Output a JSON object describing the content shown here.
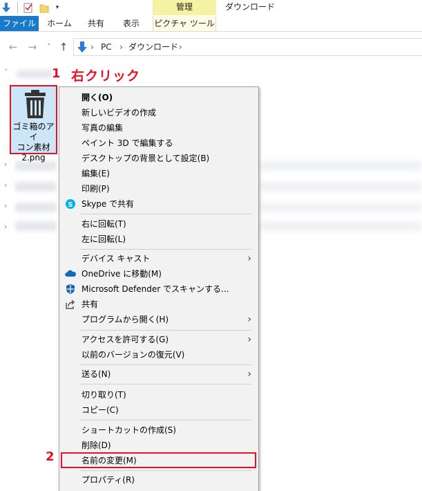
{
  "titlebar": {
    "context_tab_header": "管理",
    "folder_title": "ダウンロード"
  },
  "ribbon": {
    "tabs": [
      "ファイル",
      "ホーム",
      "共有",
      "表示",
      "ピクチャ ツール"
    ]
  },
  "address": {
    "crumbs": [
      "PC",
      "ダウンロード"
    ]
  },
  "file": {
    "name": "ゴミ箱のアイコン素材2.png",
    "name_lines": [
      "ゴミ箱のアイ",
      "コン素材",
      "2.png"
    ]
  },
  "annotations": {
    "step1": "1",
    "step1_text": "右クリック",
    "step2": "2"
  },
  "context_menu": {
    "items": [
      {
        "label": "開く(O)",
        "bold": true,
        "icon": null,
        "submenu": false
      },
      {
        "label": "新しいビデオの作成",
        "icon": null,
        "submenu": false
      },
      {
        "label": "写真の編集",
        "icon": null,
        "submenu": false
      },
      {
        "label": "ペイント 3D で編集する",
        "icon": null,
        "submenu": false
      },
      {
        "label": "デスクトップの背景として設定(B)",
        "icon": null,
        "submenu": false
      },
      {
        "label": "編集(E)",
        "icon": null,
        "submenu": false
      },
      {
        "label": "印刷(P)",
        "icon": null,
        "submenu": false
      },
      {
        "label": "Skype で共有",
        "icon": "skype-icon",
        "submenu": false
      },
      {
        "label": "右に回転(T)",
        "icon": null,
        "submenu": false
      },
      {
        "label": "左に回転(L)",
        "icon": null,
        "submenu": false
      },
      {
        "label": "デバイス キャスト",
        "icon": null,
        "submenu": true
      },
      {
        "label": "OneDrive に移動(M)",
        "icon": "onedrive-cloud-icon",
        "submenu": false
      },
      {
        "label": "Microsoft Defender でスキャンする...",
        "icon": "defender-shield-icon",
        "submenu": false
      },
      {
        "label": "共有",
        "icon": "share-icon",
        "submenu": false
      },
      {
        "label": "プログラムから開く(H)",
        "icon": null,
        "submenu": true
      },
      {
        "label": "アクセスを許可する(G)",
        "icon": null,
        "submenu": true
      },
      {
        "label": "以前のバージョンの復元(V)",
        "icon": null,
        "submenu": false
      },
      {
        "label": "送る(N)",
        "icon": null,
        "submenu": true
      },
      {
        "label": "切り取り(T)",
        "icon": null,
        "submenu": false
      },
      {
        "label": "コピー(C)",
        "icon": null,
        "submenu": false
      },
      {
        "label": "ショートカットの作成(S)",
        "icon": null,
        "submenu": false
      },
      {
        "label": "削除(D)",
        "icon": null,
        "submenu": false
      },
      {
        "label": "名前の変更(M)",
        "icon": null,
        "submenu": false
      },
      {
        "label": "プロパティ(R)",
        "icon": null,
        "submenu": false
      }
    ]
  },
  "colors": {
    "file_tab": "#1979ca",
    "context_tab": "#f6f2a4",
    "annotation_red": "#e81123",
    "selection": "#cde6f7",
    "menu_bg": "#f2f2f2"
  }
}
